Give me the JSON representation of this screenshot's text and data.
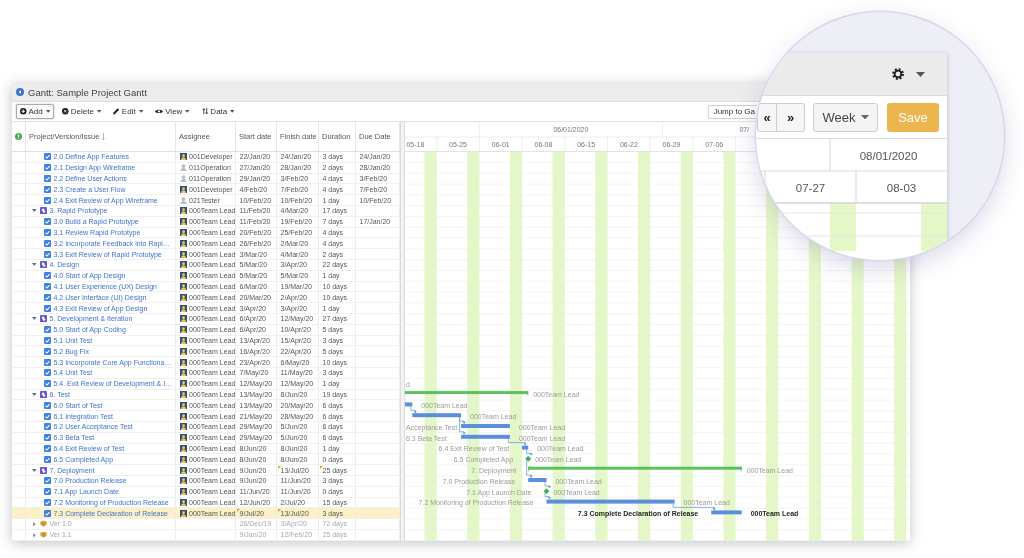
{
  "window": {
    "title": "Gantt: Sample Project Gantt"
  },
  "toolbar": {
    "menus": [
      {
        "kind": "add",
        "label": "Add",
        "selected": true
      },
      {
        "kind": "delete",
        "label": "Delete",
        "selected": false
      },
      {
        "kind": "edit",
        "label": "Edit",
        "selected": false
      },
      {
        "kind": "view",
        "label": "View",
        "selected": false
      },
      {
        "kind": "data",
        "label": "Data",
        "selected": false
      }
    ],
    "jump_button": "Jump to Ga"
  },
  "table": {
    "columns": [
      {
        "label": "Project/Version/Issue",
        "sorted": true
      },
      {
        "label": "Assignee",
        "sorted": false
      },
      {
        "label": "Start date",
        "sorted": false
      },
      {
        "label": "Finish date",
        "sorted": false
      },
      {
        "label": "Duration",
        "sorted": false
      },
      {
        "label": "Due Date",
        "sorted": false
      }
    ],
    "rows": [
      {
        "kind": "issue",
        "name": "2.0 Define App Features",
        "assignee": "001Developer",
        "avatar": {
          "kind": "photo"
        },
        "start": "22/Jan/20",
        "finish": "24/Jan/20",
        "duration": "3 days",
        "due": "24/Jan/20",
        "start_changed": false,
        "finish_changed": false,
        "duration_changed": false,
        "selected": false
      },
      {
        "kind": "issue",
        "name": "2.1 Design App Wireframe",
        "assignee": "011Operation",
        "avatar": {
          "kind": "generic"
        },
        "start": "27/Jan/20",
        "finish": "28/Jan/20",
        "duration": "2 days",
        "due": "28/Jan/20",
        "start_changed": false,
        "finish_changed": false,
        "duration_changed": false,
        "selected": false
      },
      {
        "kind": "issue",
        "name": "2.2 Define User Actions",
        "assignee": "011Operation",
        "avatar": {
          "kind": "generic"
        },
        "start": "29/Jan/20",
        "finish": "3/Feb/20",
        "duration": "4 days",
        "due": "3/Feb/20",
        "start_changed": false,
        "finish_changed": false,
        "duration_changed": false,
        "selected": false
      },
      {
        "kind": "issue",
        "name": "2.3 Create a User Flow",
        "assignee": "001Developer",
        "avatar": {
          "kind": "photo"
        },
        "start": "4/Feb/20",
        "finish": "7/Feb/20",
        "duration": "4 days",
        "due": "7/Feb/20",
        "start_changed": false,
        "finish_changed": false,
        "duration_changed": false,
        "selected": false
      },
      {
        "kind": "issue",
        "name": "2.4 Exit Review of App Wireframe",
        "assignee": "021Tester",
        "avatar": {
          "kind": "generic"
        },
        "start": "10/Feb/20",
        "finish": "10/Feb/20",
        "duration": "1 day",
        "due": "10/Feb/20",
        "start_changed": false,
        "finish_changed": false,
        "duration_changed": false,
        "selected": false
      },
      {
        "kind": "group",
        "name": "3. Rapid Prototype",
        "assignee": "000Team Lead",
        "avatar": {
          "kind": "photo"
        },
        "start": "11/Feb/20",
        "finish": "4/Mar/20",
        "duration": "17 days",
        "start_changed": false,
        "finish_changed": false,
        "duration_changed": false,
        "selected": false,
        "expanded": true,
        "children": [
          {
            "kind": "issue",
            "name": "3.0 Build a Rapid Prototype",
            "assignee": "000Team Lead",
            "avatar": {
              "kind": "photo"
            },
            "start": "11/Feb/20",
            "finish": "19/Feb/20",
            "duration": "7 days",
            "due": "17/Jan/20",
            "start_changed": false,
            "finish_changed": false,
            "duration_changed": false,
            "selected": false
          },
          {
            "kind": "issue",
            "name": "3.1 Review Rapid Prototype",
            "assignee": "000Team Lead",
            "avatar": {
              "kind": "photo"
            },
            "start": "20/Feb/20",
            "finish": "25/Feb/20",
            "duration": "4 days",
            "start_changed": false,
            "finish_changed": false,
            "duration_changed": false,
            "selected": false
          },
          {
            "kind": "issue",
            "name": "3.2 Incorporate Feedback into Rapi…",
            "assignee": "000Team Lead",
            "avatar": {
              "kind": "photo"
            },
            "start": "26/Feb/20",
            "finish": "2/Mar/20",
            "duration": "4 days",
            "start_changed": false,
            "finish_changed": false,
            "duration_changed": false,
            "selected": false
          },
          {
            "kind": "issue",
            "name": "3.3 Exit Review of Rapid Prototype",
            "assignee": "000Team Lead",
            "avatar": {
              "kind": "photo"
            },
            "start": "3/Mar/20",
            "finish": "4/Mar/20",
            "duration": "2 days",
            "start_changed": false,
            "finish_changed": false,
            "duration_changed": false,
            "selected": false
          }
        ]
      },
      {
        "kind": "group",
        "name": "4. Design",
        "assignee": "000Team Lead",
        "avatar": {
          "kind": "photo"
        },
        "start": "5/Mar/20",
        "finish": "3/Apr/20",
        "duration": "22 days",
        "start_changed": false,
        "finish_changed": false,
        "duration_changed": false,
        "selected": false,
        "expanded": true,
        "children": [
          {
            "kind": "issue",
            "name": "4.0 Start of App Design",
            "assignee": "000Team Lead",
            "avatar": {
              "kind": "photo"
            },
            "start": "5/Mar/20",
            "finish": "5/Mar/20",
            "duration": "1 day",
            "start_changed": false,
            "finish_changed": false,
            "duration_changed": false,
            "selected": false
          },
          {
            "kind": "issue",
            "name": "4.1 User Experience (UX) Design",
            "assignee": "000Team Lead",
            "avatar": {
              "kind": "photo"
            },
            "start": "6/Mar/20",
            "finish": "19/Mar/20",
            "duration": "10 days",
            "start_changed": false,
            "finish_changed": false,
            "duration_changed": false,
            "selected": false
          },
          {
            "kind": "issue",
            "name": "4.2 User Interface (UI) Design",
            "assignee": "000Team Lead",
            "avatar": {
              "kind": "photo"
            },
            "start": "20/Mar/20",
            "finish": "2/Apr/20",
            "duration": "10 days",
            "start_changed": false,
            "finish_changed": false,
            "duration_changed": false,
            "selected": false
          },
          {
            "kind": "issue",
            "name": "4.3 Exit Review of App Design",
            "assignee": "000Team Lead",
            "avatar": {
              "kind": "photo"
            },
            "start": "3/Apr/20",
            "finish": "3/Apr/20",
            "duration": "1 day",
            "start_changed": false,
            "finish_changed": false,
            "duration_changed": false,
            "selected": false
          }
        ]
      },
      {
        "kind": "group",
        "name": "5. Development & Iteration",
        "assignee": "000Team Lead",
        "avatar": {
          "kind": "photo"
        },
        "start": "6/Apr/20",
        "finish": "12/May/20",
        "duration": "27 days",
        "start_changed": false,
        "finish_changed": false,
        "duration_changed": false,
        "selected": false,
        "expanded": true,
        "children": [
          {
            "kind": "issue",
            "name": "5.0 Start of App Coding",
            "assignee": "000Team Lead",
            "avatar": {
              "kind": "photo"
            },
            "start": "6/Apr/20",
            "finish": "10/Apr/20",
            "duration": "5 days",
            "start_changed": false,
            "finish_changed": false,
            "duration_changed": false,
            "selected": false
          },
          {
            "kind": "issue",
            "name": "5.1 Unit Test",
            "assignee": "000Team Lead",
            "avatar": {
              "kind": "photo"
            },
            "start": "13/Apr/20",
            "finish": "15/Apr/20",
            "duration": "3 days",
            "start_changed": false,
            "finish_changed": false,
            "duration_changed": false,
            "selected": false
          },
          {
            "kind": "issue",
            "name": "5.2 Bug Fix",
            "assignee": "000Team Lead",
            "avatar": {
              "kind": "photo"
            },
            "start": "16/Apr/20",
            "finish": "22/Apr/20",
            "duration": "5 days",
            "start_changed": false,
            "finish_changed": false,
            "duration_changed": false,
            "selected": false
          },
          {
            "kind": "issue",
            "name": "5.3 Incorporate Core App Functiona…",
            "assignee": "000Team Lead",
            "avatar": {
              "kind": "photo"
            },
            "start": "23/Apr/20",
            "finish": "6/May/20",
            "duration": "10 days",
            "start_changed": false,
            "finish_changed": false,
            "duration_changed": false,
            "selected": false
          },
          {
            "kind": "issue",
            "name": "5.4 Unit Test",
            "assignee": "000Team Lead",
            "avatar": {
              "kind": "photo"
            },
            "start": "7/May/20",
            "finish": "11/May/20",
            "duration": "3 days",
            "start_changed": false,
            "finish_changed": false,
            "duration_changed": false,
            "selected": false
          },
          {
            "kind": "issue",
            "name": "5.4. Exit Review of Development & I…",
            "assignee": "000Team Lead",
            "avatar": {
              "kind": "photo"
            },
            "start": "12/May/20",
            "finish": "12/May/20",
            "duration": "1 day",
            "start_changed": false,
            "finish_changed": false,
            "duration_changed": false,
            "selected": false,
            "bar": {
              "kind": "task",
              "bar_label": "d",
              "linked": false
            }
          }
        ]
      },
      {
        "kind": "group",
        "name": "6. Test",
        "assignee": "000Team Lead",
        "avatar": {
          "kind": "photo"
        },
        "start": "13/May/20",
        "finish": "8/Jun/20",
        "duration": "19 days",
        "start_changed": false,
        "finish_changed": false,
        "duration_changed": false,
        "selected": false,
        "expanded": true,
        "bar": {
          "kind": "summary",
          "bar_label": "000Team Lead",
          "linked": false
        },
        "children": [
          {
            "kind": "issue",
            "name": "6.0 Start of Test",
            "assignee": "000Team Lead",
            "avatar": {
              "kind": "photo"
            },
            "start": "13/May/20",
            "finish": "20/May/20",
            "duration": "6 days",
            "start_changed": false,
            "finish_changed": false,
            "duration_changed": false,
            "selected": false,
            "bar": {
              "kind": "task",
              "bar_label": "000Team Lead",
              "linked": false
            }
          },
          {
            "kind": "issue",
            "name": "6.1 Integration Test",
            "assignee": "000Team Lead",
            "avatar": {
              "kind": "photo"
            },
            "start": "21/May/20",
            "finish": "28/May/20",
            "duration": "6 days",
            "start_changed": false,
            "finish_changed": false,
            "duration_changed": false,
            "selected": false,
            "bar": {
              "kind": "task",
              "bar_label": "000Team Lead",
              "linked": true
            }
          },
          {
            "kind": "issue",
            "name": "6.2 User Acceptance Test",
            "assignee": "000Team Lead",
            "avatar": {
              "kind": "photo"
            },
            "start": "29/May/20",
            "finish": "5/Jun/20",
            "duration": "6 days",
            "start_changed": false,
            "finish_changed": false,
            "duration_changed": false,
            "selected": false,
            "bar": {
              "kind": "task",
              "task_label": "Acceptance Test",
              "bar_label": "000Team Lead",
              "linked": true
            }
          },
          {
            "kind": "issue",
            "name": "6.3 Beta Test",
            "assignee": "000Team Lead",
            "avatar": {
              "kind": "photo"
            },
            "start": "29/May/20",
            "finish": "5/Jun/20",
            "duration": "6 days",
            "start_changed": false,
            "finish_changed": false,
            "duration_changed": false,
            "selected": false,
            "bar": {
              "kind": "task",
              "task_label": "6.3 Beta Test",
              "bar_label": "000Team Lead",
              "linked": true
            }
          },
          {
            "kind": "issue",
            "name": "6.4 Exit Review of Test",
            "assignee": "000Team Lead",
            "avatar": {
              "kind": "photo"
            },
            "start": "8/Jun/20",
            "finish": "8/Jun/20",
            "duration": "1 day",
            "start_changed": false,
            "finish_changed": false,
            "duration_changed": false,
            "selected": false,
            "bar": {
              "kind": "task",
              "task_label": "6.4 Exit Review of Test",
              "bar_label": "000Team Lead",
              "linked": true
            }
          },
          {
            "kind": "issue",
            "name": "6.5 Completed App",
            "assignee": "000Team Lead",
            "avatar": {
              "kind": "photo"
            },
            "start": "8/Jun/20",
            "finish": "8/Jun/20",
            "duration": "0 days",
            "start_changed": false,
            "finish_changed": false,
            "duration_changed": false,
            "selected": false,
            "bar": {
              "kind": "milestone",
              "task_label": "6.5 Completed App",
              "bar_label": "000Team Lead",
              "linked": true
            }
          }
        ]
      },
      {
        "kind": "group",
        "name": "7. Deployment",
        "assignee": "000Team Lead",
        "avatar": {
          "kind": "photo"
        },
        "start": "9/Jun/20",
        "finish": "13/Jul/20",
        "duration": "25 days",
        "start_changed": false,
        "finish_changed": true,
        "duration_changed": true,
        "selected": false,
        "expanded": true,
        "bar": {
          "kind": "summary",
          "task_label": "7. Deployment",
          "bar_label": "000Team Lead",
          "linked": false
        },
        "children": [
          {
            "kind": "issue",
            "name": "7.0 Production Release",
            "assignee": "000Team Lead",
            "avatar": {
              "kind": "photo"
            },
            "start": "9/Jun/20",
            "finish": "11/Jun/20",
            "duration": "3 days",
            "start_changed": false,
            "finish_changed": false,
            "duration_changed": false,
            "selected": false,
            "bar": {
              "kind": "task",
              "task_label": "7.0 Production Release",
              "bar_label": "000Team Lead",
              "linked": true
            }
          },
          {
            "kind": "issue",
            "name": "7.1 App Launch Date",
            "assignee": "000Team Lead",
            "avatar": {
              "kind": "photo"
            },
            "start": "11/Jun/20",
            "finish": "11/Jun/20",
            "duration": "0 days",
            "start_changed": false,
            "finish_changed": false,
            "duration_changed": false,
            "selected": false,
            "bar": {
              "kind": "milestone",
              "task_label": "7.1 App Launch Date",
              "bar_label": "000Team Lead",
              "linked": true
            }
          },
          {
            "kind": "issue",
            "name": "7.2 Monitoring of Production Release",
            "assignee": "000Team Lead",
            "avatar": {
              "kind": "photo"
            },
            "start": "12/Jun/20",
            "finish": "2/Jul/20",
            "duration": "15 days",
            "start_changed": false,
            "finish_changed": false,
            "duration_changed": false,
            "selected": false,
            "bar": {
              "kind": "task",
              "task_label": "7.2 Monitoring of Production Release",
              "bar_label": "000Team Lead",
              "linked": true
            }
          },
          {
            "kind": "issue",
            "name": "7.3 Complete Declaration of Release",
            "assignee": "000Team Lead",
            "avatar": {
              "kind": "photo"
            },
            "start": "9/Jul/20",
            "finish": "13/Jul/20",
            "duration": "3 days",
            "start_changed": true,
            "finish_changed": true,
            "duration_changed": false,
            "selected": true,
            "bar": {
              "kind": "task",
              "task_label": "7.3 Complete Declaration of Release",
              "bar_label": "000Team Lead",
              "linked": true
            }
          }
        ]
      },
      {
        "kind": "version",
        "name": "Ver 1.0",
        "start": "26/Dec/19",
        "finish": "3/Apr/20",
        "duration": "72 days",
        "start_changed": false,
        "finish_changed": false,
        "duration_changed": false,
        "selected": false,
        "expanded": false
      },
      {
        "kind": "version",
        "name": "Ver 1.1",
        "start": "9/Jan/20",
        "finish": "12/Feb/20",
        "duration": "25 days",
        "start_changed": false,
        "finish_changed": false,
        "duration_changed": false,
        "selected": false,
        "expanded": false
      }
    ]
  },
  "gantt": {
    "months": [
      "06/01/2020",
      "07/"
    ],
    "weeks": [
      "05-18",
      "05-25",
      "06-01",
      "06-08",
      "06-15",
      "06-22",
      "06-29",
      "07-06"
    ]
  },
  "magnifier": {
    "nav_buttons": [
      "«",
      "»"
    ],
    "scale_dropdown": "Week",
    "save_button": "Save",
    "month_label": "08/01/2020",
    "weeks": [
      "07-27",
      "08-03"
    ]
  }
}
